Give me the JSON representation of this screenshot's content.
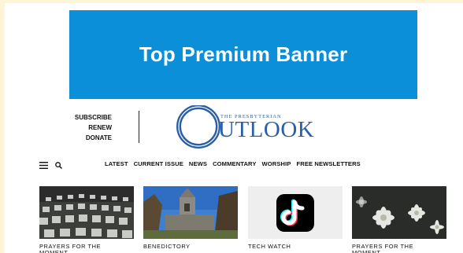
{
  "banner": {
    "text": "Top Premium Banner"
  },
  "account_links": [
    "SUBSCRIBE",
    "RENEW",
    "DONATE"
  ],
  "logo": {
    "small": "THE PRESBYTERIAN",
    "big": "UTLOOK"
  },
  "nav": {
    "items": [
      "LATEST",
      "CURRENT ISSUE",
      "NEWS",
      "COMMENTARY",
      "WORSHIP",
      "FREE NEWSLETTERS"
    ],
    "icons": [
      "menu-icon",
      "search-icon"
    ]
  },
  "cards": [
    {
      "label": "PRAYERS FOR THE MOMENT",
      "image": "rows of candles"
    },
    {
      "label": "BENEDICTORY",
      "image": "stone church tower"
    },
    {
      "label": "TECH WATCH",
      "image": "tiktok logo"
    },
    {
      "label": "PRAYERS FOR THE MOMENT",
      "image": "white daisies"
    }
  ],
  "colors": {
    "banner": "#0b8fd8",
    "logo": "#2a5ea8",
    "page_edge": "#fdf5d6"
  }
}
